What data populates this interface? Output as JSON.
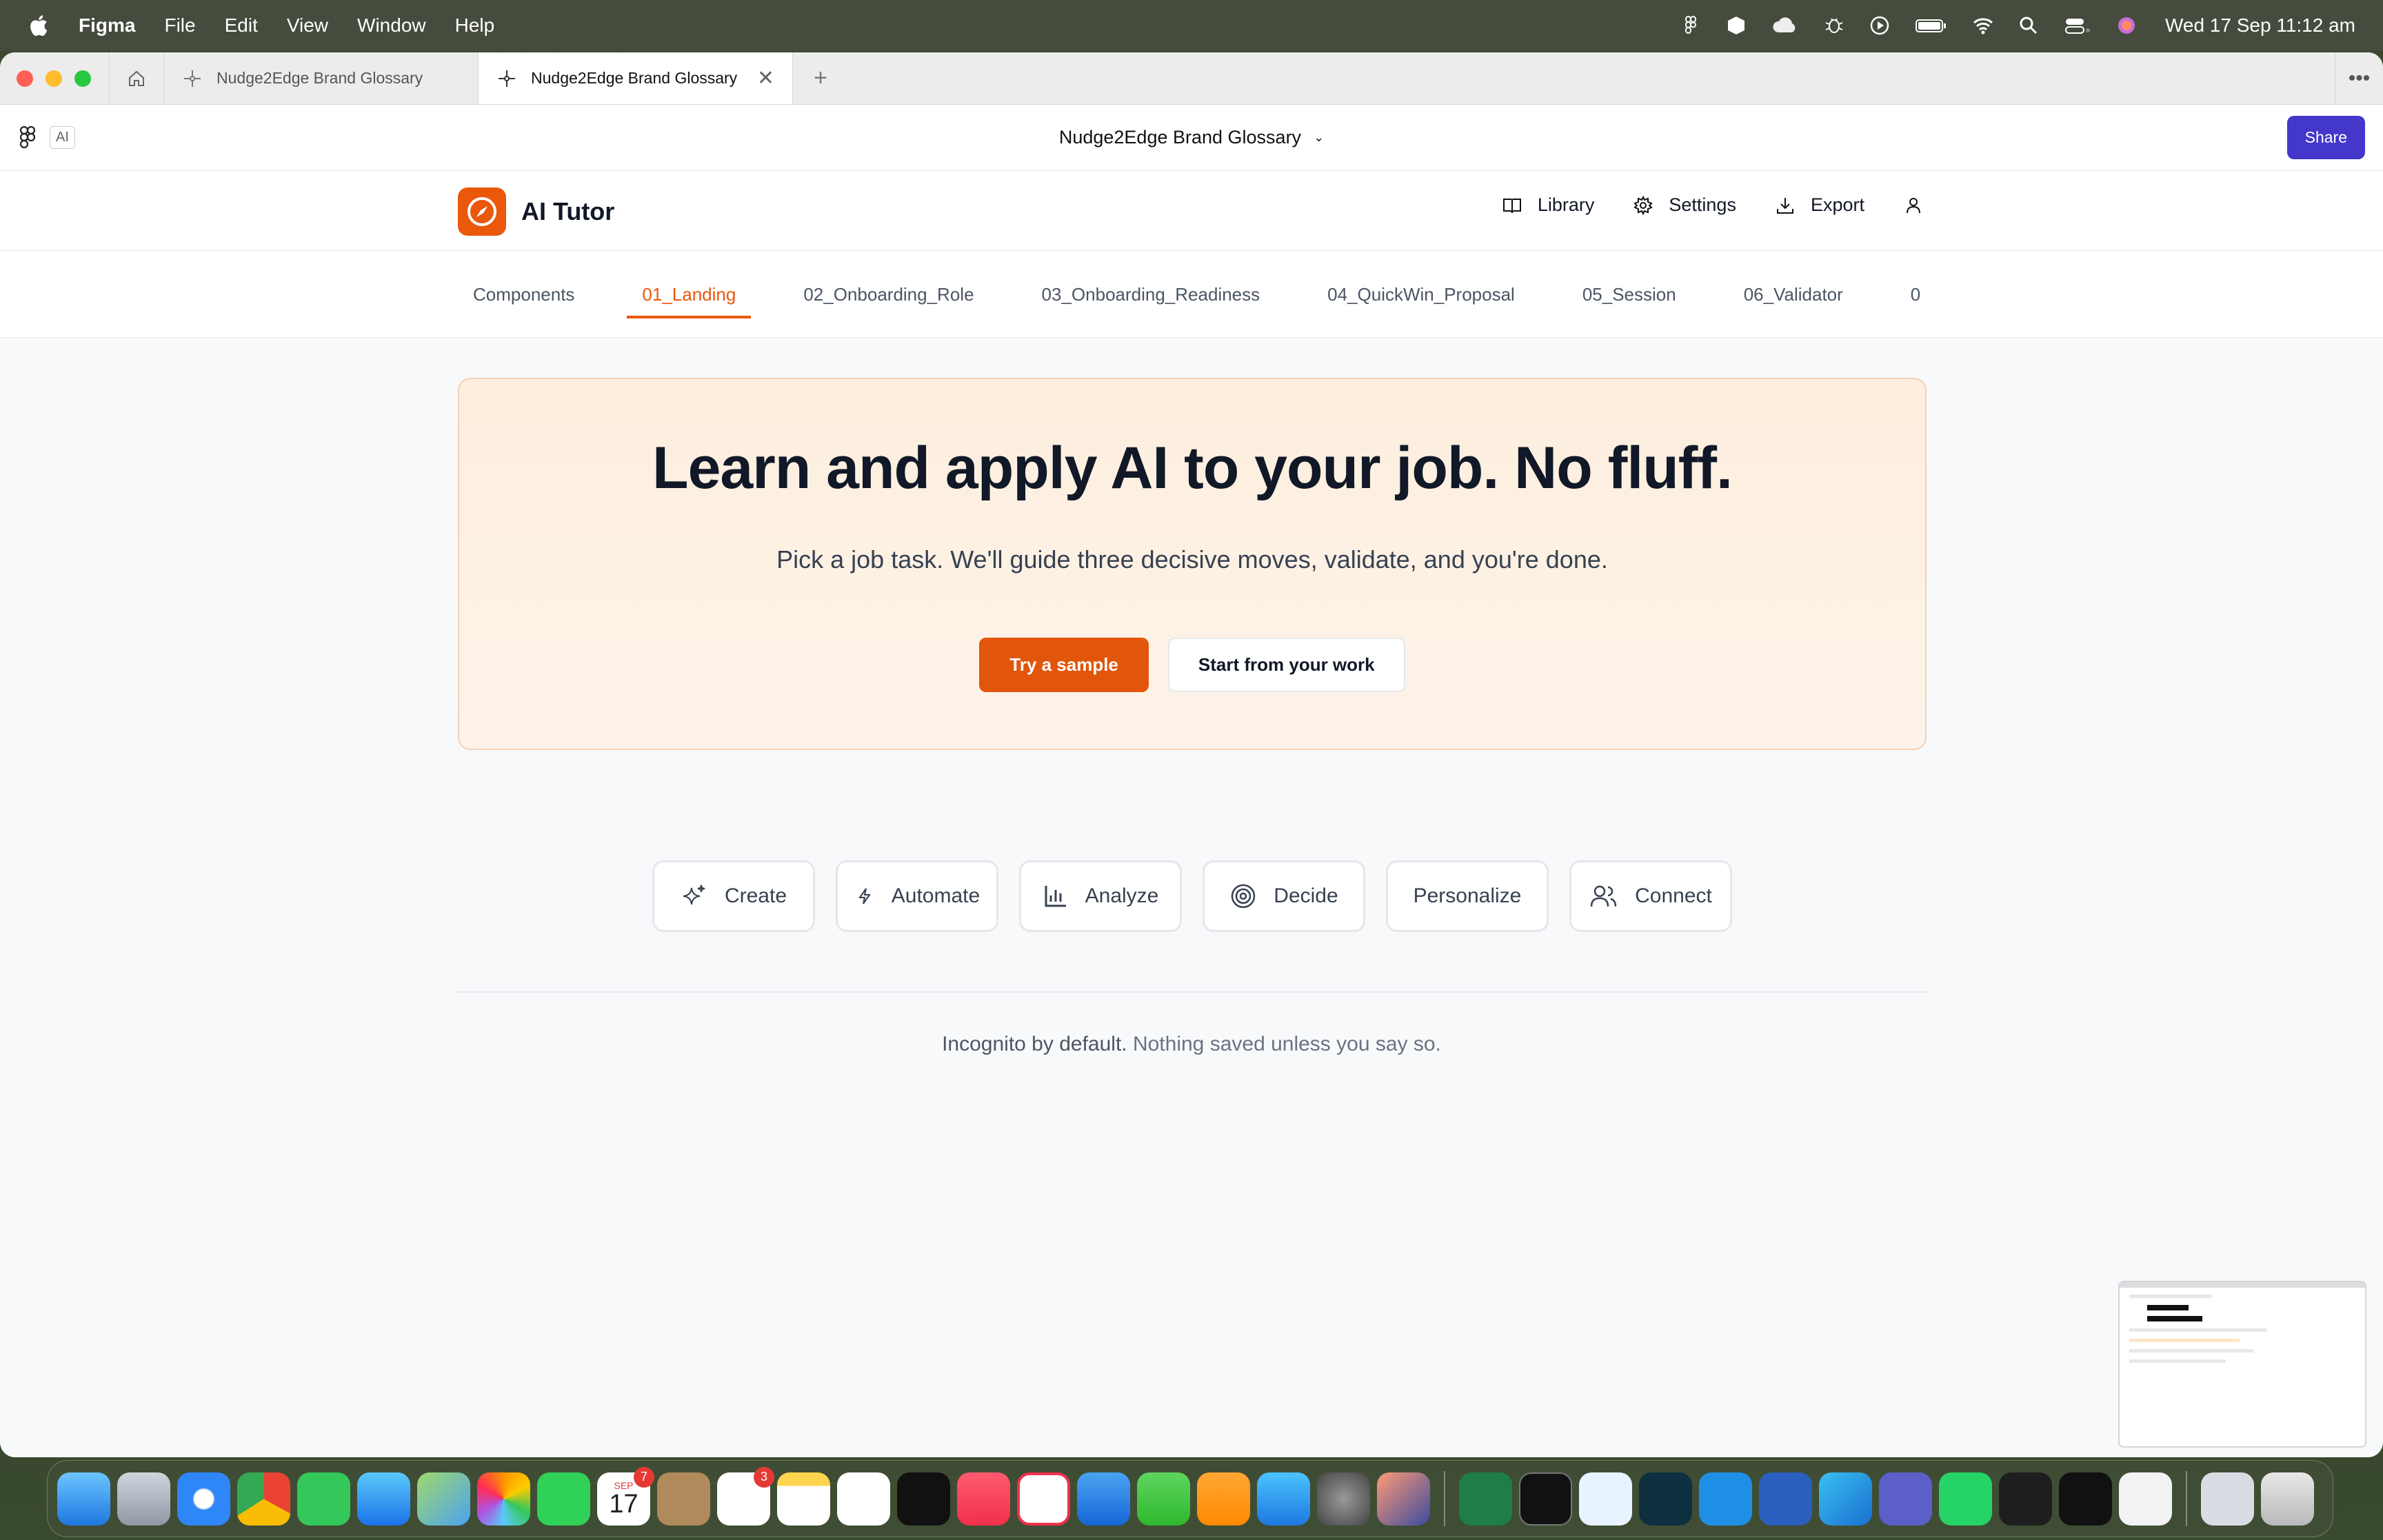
{
  "menubar": {
    "app": "Figma",
    "items": [
      "File",
      "Edit",
      "View",
      "Window",
      "Help"
    ],
    "clock": "Wed 17 Sep  11:12 am"
  },
  "tabs": [
    {
      "label": "Nudge2Edge Brand Glossary",
      "active": false
    },
    {
      "label": "Nudge2Edge Brand Glossary",
      "active": true
    }
  ],
  "toolbar": {
    "ai_chip": "AI",
    "doc_title": "Nudge2Edge Brand Glossary",
    "share_label": "Share"
  },
  "app": {
    "name": "AI Tutor",
    "actions": {
      "library": "Library",
      "settings": "Settings",
      "export": "Export"
    }
  },
  "nav": {
    "tabs": [
      "Components",
      "01_Landing",
      "02_Onboarding_Role",
      "03_Onboarding_Readiness",
      "04_QuickWin_Proposal",
      "05_Session",
      "06_Validator",
      "0"
    ],
    "active_index": 1
  },
  "hero": {
    "title": "Learn and apply AI to your job. No fluff.",
    "subtitle": "Pick a job task. We'll guide three decisive moves, validate, and you're done.",
    "primary_cta": "Try a sample",
    "secondary_cta": "Start from your work"
  },
  "categories": [
    {
      "label": "Create",
      "icon": "sparkles-icon"
    },
    {
      "label": "Automate",
      "icon": "lightning-icon"
    },
    {
      "label": "Analyze",
      "icon": "bar-chart-icon"
    },
    {
      "label": "Decide",
      "icon": "target-icon"
    },
    {
      "label": "Personalize",
      "icon": ""
    },
    {
      "label": "Connect",
      "icon": "users-icon"
    }
  ],
  "footer": {
    "strong": "Incognito by default.",
    "rest": " Nothing saved unless you say so."
  },
  "dock": {
    "calendar_month": "SEP",
    "calendar_day": "17",
    "calendar_badge": "7",
    "reminders_badge": "3"
  },
  "colors": {
    "accent": "#ea580c",
    "primary_button": "#e1560a",
    "share_button": "#4338ca",
    "hero_bg": "#fdeedd"
  }
}
